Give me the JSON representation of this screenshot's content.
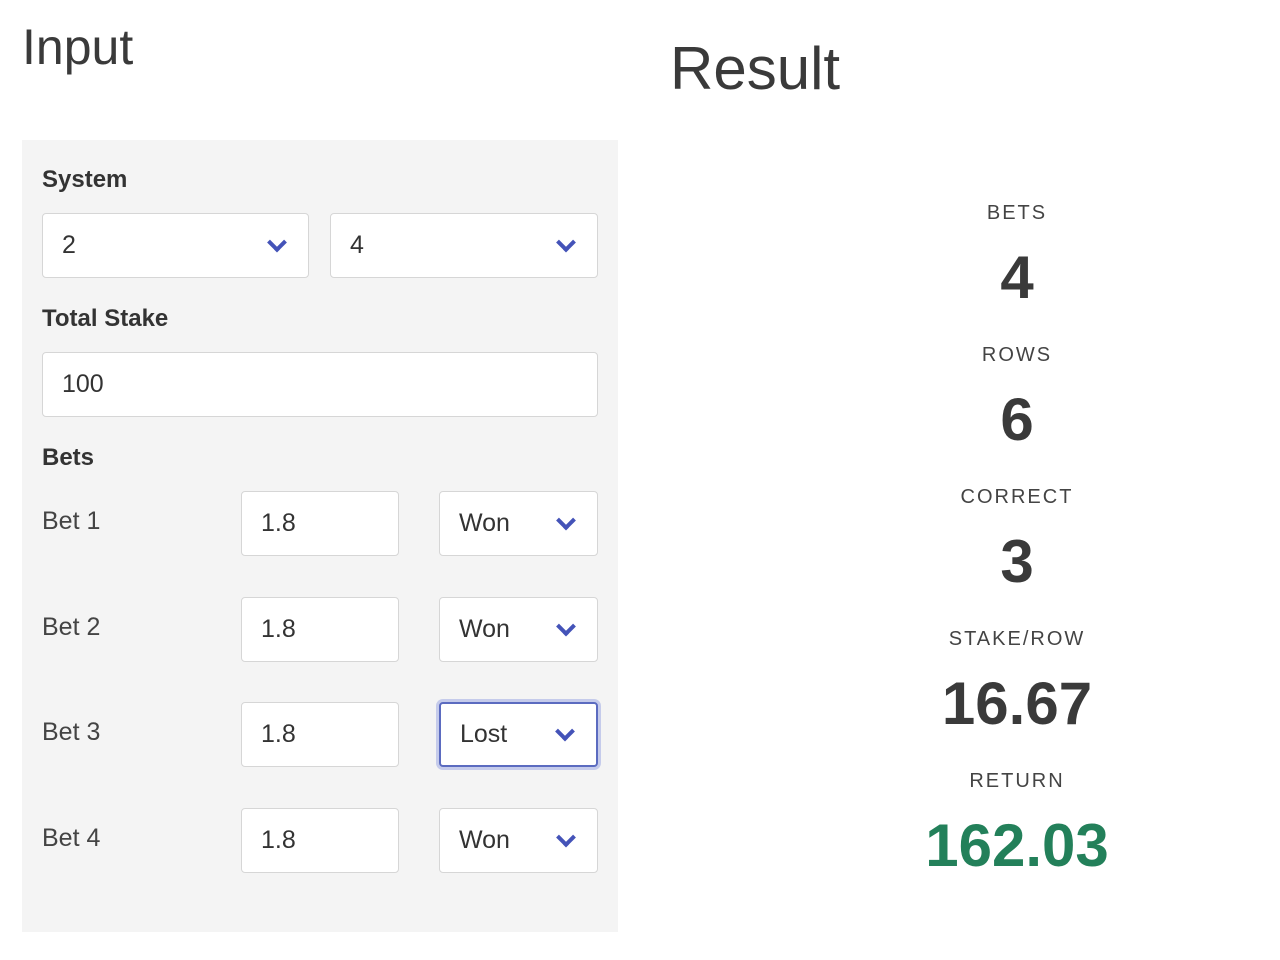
{
  "input": {
    "title": "Input",
    "system_label": "System",
    "system": [
      "2",
      "4"
    ],
    "stake_label": "Total Stake",
    "stake": "100",
    "bets_label": "Bets",
    "bets": [
      {
        "label": "Bet 1",
        "odds": "1.8",
        "status": "Won"
      },
      {
        "label": "Bet 2",
        "odds": "1.8",
        "status": "Won"
      },
      {
        "label": "Bet 3",
        "odds": "1.8",
        "status": "Lost"
      },
      {
        "label": "Bet 4",
        "odds": "1.8",
        "status": "Won"
      }
    ]
  },
  "result": {
    "title": "Result",
    "items": [
      {
        "label": "BETS",
        "value": "4"
      },
      {
        "label": "ROWS",
        "value": "6"
      },
      {
        "label": "CORRECT",
        "value": "3"
      },
      {
        "label": "STAKE/ROW",
        "value": "16.67"
      },
      {
        "label": "RETURN",
        "value": "162.03"
      }
    ]
  },
  "colors": {
    "accent": "#4453b8",
    "return": "#23805a"
  }
}
